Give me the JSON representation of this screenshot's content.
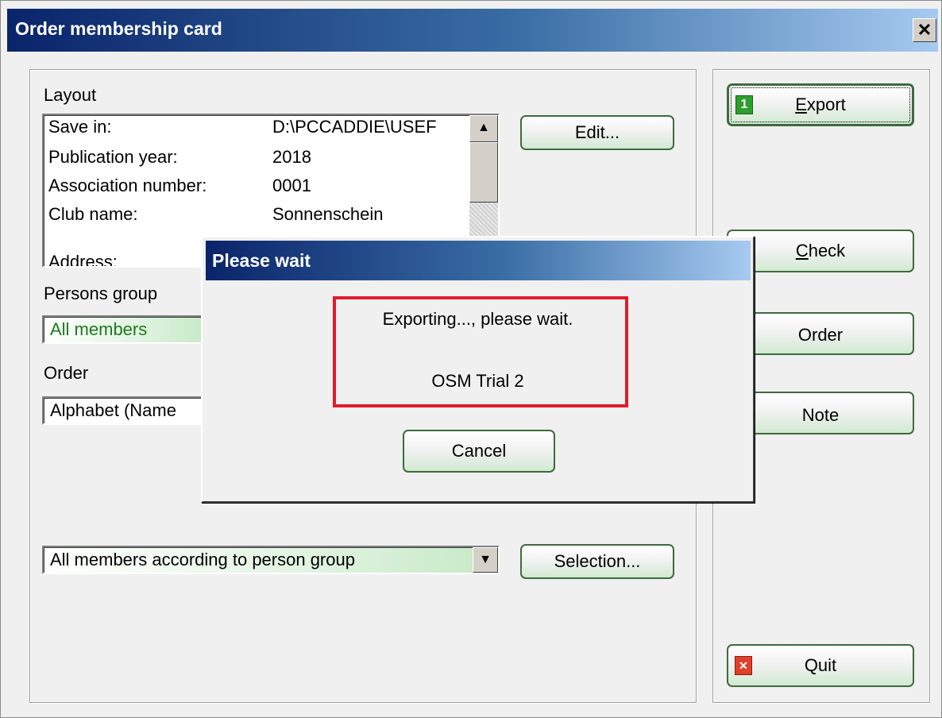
{
  "window": {
    "title": "Order membership card",
    "close_glyph": "✕"
  },
  "layout": {
    "label": "Layout",
    "rows": [
      {
        "label": "Save in:",
        "value": "D:\\PCCADDIE\\USEF"
      },
      {
        "label": "Publication year:",
        "value": "2018"
      },
      {
        "label": "Association number:",
        "value": "0001"
      },
      {
        "label": "Club name:",
        "value": "Sonnenschein"
      },
      {
        "label": "",
        "value": ""
      },
      {
        "label": "Address:",
        "value": ""
      }
    ],
    "edit_button": "Edit..."
  },
  "persons_group": {
    "label_pre": "Persons ",
    "label_acc": "g",
    "label_post": "roup",
    "value": "All members"
  },
  "order": {
    "label": "Order",
    "value": "Alphabet (Name"
  },
  "selection": {
    "value": "All members according to person group",
    "button": "Selection..."
  },
  "side_buttons": {
    "export_pre": "",
    "export_acc": "E",
    "export_post": "xport",
    "export_badge": "1",
    "check_pre": "",
    "check_acc": "C",
    "check_post": "heck",
    "order": "Order",
    "note": "Note",
    "quit": "Quit",
    "quit_badge": "✕"
  },
  "dialog": {
    "title": "Please wait",
    "message": "Exporting..., please wait.",
    "detail": "OSM Trial 2",
    "cancel": "Cancel"
  },
  "colors": {
    "highlight": "#e01b2c",
    "badge_green": "#2e9e2e",
    "badge_red": "#e0402a",
    "combo_green_text": "#1c7a1c"
  }
}
